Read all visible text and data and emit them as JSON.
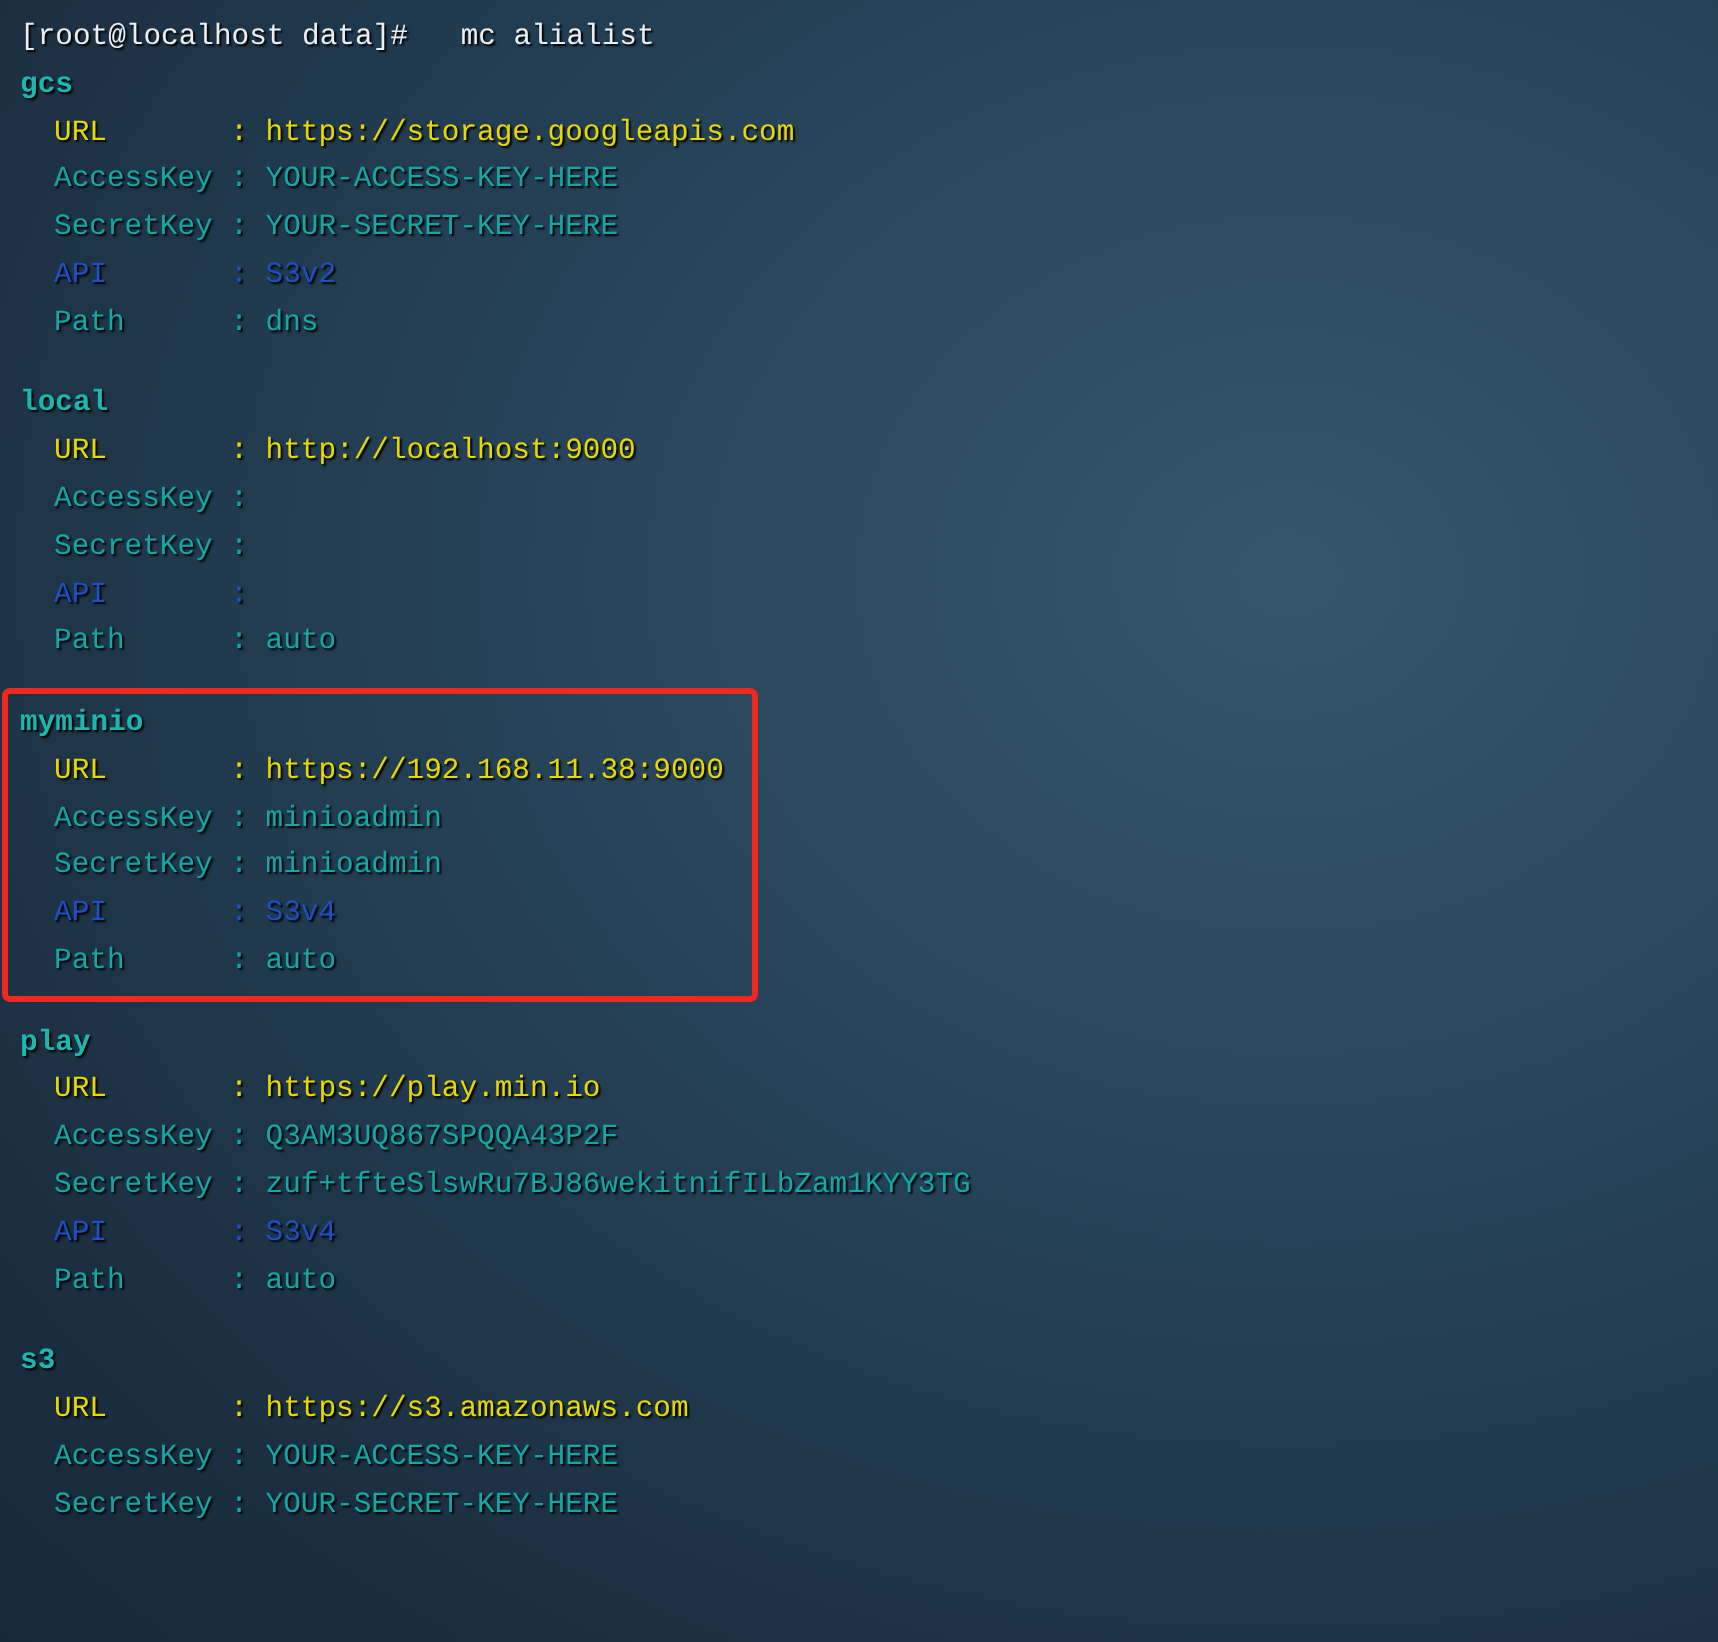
{
  "terminal": {
    "prompt": "[root@localhost data]#",
    "command": "mc alialist",
    "aliases": [
      {
        "name": "gcs",
        "highlighted": false,
        "fields": [
          {
            "kind": "url",
            "label": "URL",
            "sep": ":",
            "value": "https://storage.googleapis.com"
          },
          {
            "kind": "key",
            "label": "AccessKey",
            "sep": ":",
            "value": "YOUR-ACCESS-KEY-HERE"
          },
          {
            "kind": "key",
            "label": "SecretKey",
            "sep": ":",
            "value": "YOUR-SECRET-KEY-HERE"
          },
          {
            "kind": "api",
            "label": "API",
            "sep": ":",
            "value": "S3v2"
          },
          {
            "kind": "path",
            "label": "Path",
            "sep": ":",
            "value": "dns"
          }
        ]
      },
      {
        "name": "local",
        "highlighted": false,
        "fields": [
          {
            "kind": "url",
            "label": "URL",
            "sep": ":",
            "value": "http://localhost:9000"
          },
          {
            "kind": "key",
            "label": "AccessKey",
            "sep": ":"
          },
          {
            "kind": "key",
            "label": "SecretKey",
            "sep": ":"
          },
          {
            "kind": "api",
            "label": "API",
            "sep": ":"
          },
          {
            "kind": "path",
            "label": "Path",
            "sep": ":",
            "value": "auto"
          }
        ]
      },
      {
        "name": "myminio",
        "highlighted": true,
        "fields": [
          {
            "kind": "url",
            "label": "URL",
            "sep": ":",
            "value": "https://192.168.11.38:9000"
          },
          {
            "kind": "key",
            "label": "AccessKey",
            "sep": ":",
            "value": "minioadmin"
          },
          {
            "kind": "key",
            "label": "SecretKey",
            "sep": ":",
            "value": "minioadmin"
          },
          {
            "kind": "api",
            "label": "API",
            "sep": ":",
            "value": "S3v4"
          },
          {
            "kind": "path",
            "label": "Path",
            "sep": ":",
            "value": "auto"
          }
        ]
      },
      {
        "name": "play",
        "highlighted": false,
        "fields": [
          {
            "kind": "url",
            "label": "URL",
            "sep": ":",
            "value": "https://play.min.io"
          },
          {
            "kind": "key",
            "label": "AccessKey",
            "sep": ":",
            "value": "Q3AM3UQ867SPQQA43P2F"
          },
          {
            "kind": "key",
            "label": "SecretKey",
            "sep": ":",
            "value": "zuf+tfteSlswRu7BJ86wekitnifILbZam1KYY3TG"
          },
          {
            "kind": "api",
            "label": "API",
            "sep": ":",
            "value": "S3v4"
          },
          {
            "kind": "path",
            "label": "Path",
            "sep": ":",
            "value": "auto"
          }
        ]
      },
      {
        "name": "s3",
        "highlighted": false,
        "fields": [
          {
            "kind": "url",
            "label": "URL",
            "sep": ":",
            "value": "https://s3.amazonaws.com"
          },
          {
            "kind": "key",
            "label": "AccessKey",
            "sep": ":",
            "value": "YOUR-ACCESS-KEY-HERE"
          },
          {
            "kind": "key",
            "label": "SecretKey",
            "sep": ":",
            "value": "YOUR-SECRET-KEY-HERE"
          }
        ]
      }
    ]
  }
}
